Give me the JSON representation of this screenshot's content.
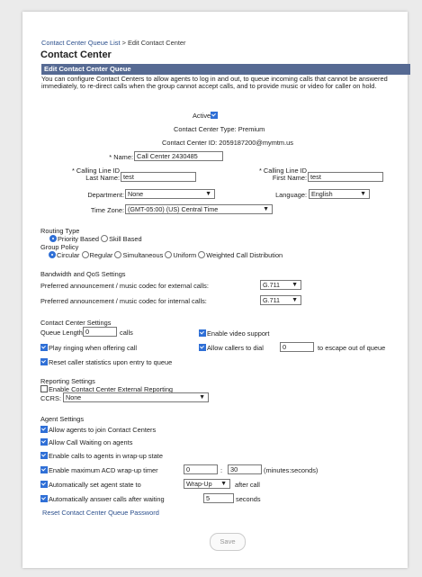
{
  "breadcrumb": {
    "link": "Contact Center Queue List",
    "sep": ">",
    "current": "Edit Contact Center"
  },
  "page_title": "Contact Center",
  "section_title": "Edit Contact Center Queue",
  "description": "You can configure Contact Centers to allow agents to log in and out, to queue incoming calls that cannot be answered immediately, to re-direct calls when the group cannot accept calls, and to provide music or video for caller on hold.",
  "active": {
    "label": "Active",
    "checked": true
  },
  "type_line": "Contact Center Type: Premium",
  "id_line": "Contact Center ID: 2059187200@mymtm.us",
  "form": {
    "name_label": "* Name:",
    "name_value": "Call Center 2430485",
    "clid_last_label1": "* Calling Line ID",
    "clid_last_label2": "Last Name:",
    "clid_last_value": "test",
    "clid_first_label1": "* Calling Line ID",
    "clid_first_label2": "First Name:",
    "clid_first_value": "test",
    "department_label": "Department:",
    "department_value": "None",
    "language_label": "Language:",
    "language_value": "English",
    "timezone_label": "Time Zone:",
    "timezone_value": "(GMT-05:00) (US) Central Time"
  },
  "routing": {
    "title": "Routing Type",
    "options": [
      "Priority Based",
      "Skill Based"
    ],
    "selected": "Priority Based"
  },
  "group_policy": {
    "title": "Group Policy",
    "options": [
      "Circular",
      "Regular",
      "Simultaneous",
      "Uniform",
      "Weighted Call Distribution"
    ],
    "selected": "Circular"
  },
  "bandwidth": {
    "title": "Bandwidth and QoS Settings",
    "external_label": "Preferred announcement / music codec for external calls:",
    "external_value": "G.711",
    "internal_label": "Preferred announcement / music codec for internal calls:",
    "internal_value": "G.711"
  },
  "cc_settings": {
    "title": "Contact Center Settings",
    "queue_length_label": "Queue Length:",
    "queue_length_value": "0",
    "calls_label": "calls",
    "video_support": "Enable video support",
    "play_ringing": "Play ringing when offering call",
    "allow_dial": "Allow callers to dial",
    "dial_value": "0",
    "escape_label": "to escape out of queue",
    "reset_stats": "Reset caller statistics upon entry to queue"
  },
  "reporting": {
    "title": "Reporting Settings",
    "enable_label": "Enable Contact Center External Reporting",
    "ccrs_label": "CCRS:",
    "ccrs_value": "None"
  },
  "agent": {
    "title": "Agent Settings",
    "join": "Allow agents to join Contact Centers",
    "call_waiting": "Allow Call Waiting on agents",
    "wrapup_calls": "Enable calls to agents in wrap-up state",
    "max_acd": "Enable maximum ACD wrap-up timer",
    "acd_min": "0",
    "colon": ":",
    "acd_sec": "30",
    "acd_units": "(minutes:seconds)",
    "auto_state": "Automatically set agent state to",
    "state_value": "Wrap-Up",
    "after_call": "after call",
    "auto_answer": "Automatically answer calls after waiting",
    "wait_value": "5",
    "seconds": "seconds"
  },
  "reset_password_link": "Reset Contact Center Queue Password",
  "save_label": "Save"
}
